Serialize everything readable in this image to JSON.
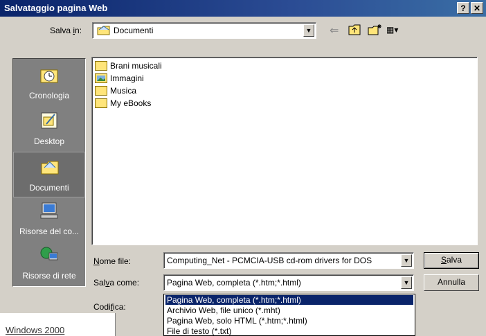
{
  "window": {
    "title": "Salvataggio pagina Web",
    "help_label": "?",
    "close_label": "✕"
  },
  "save_in": {
    "label_pre": "Salva ",
    "label_accel": "i",
    "label_post": "n:",
    "value": "Documenti",
    "icon": "folder-open-icon"
  },
  "toolbar": {
    "back_label": "⇐",
    "up_label": "⇧",
    "new_folder_label": "✱",
    "view_label": "▦▾"
  },
  "places": [
    {
      "label": "Cronologia",
      "icon": "history-icon",
      "selected": false
    },
    {
      "label": "Desktop",
      "icon": "desktop-icon",
      "selected": false
    },
    {
      "label": "Documenti",
      "icon": "documents-icon",
      "selected": true
    },
    {
      "label": "Risorse del co...",
      "icon": "computer-icon",
      "selected": false
    },
    {
      "label": "Risorse di rete",
      "icon": "network-icon",
      "selected": false
    }
  ],
  "files": [
    {
      "name": "Brani musicali",
      "icon": "folder-icon"
    },
    {
      "name": "Immagini",
      "icon": "folder-pictures-icon"
    },
    {
      "name": "Musica",
      "icon": "folder-icon"
    },
    {
      "name": "My eBooks",
      "icon": "folder-icon"
    }
  ],
  "filename": {
    "label_accel": "N",
    "label_post": "ome file:",
    "value": "Computing_Net - PCMCIA-USB cd-rom drivers for DOS"
  },
  "save_as": {
    "label_pre": "Sal",
    "label_accel": "v",
    "label_post": "a come:",
    "value": "Pagina Web, completa (*.htm;*.html)"
  },
  "encoding": {
    "label_pre": "Codi",
    "label_accel": "f",
    "label_post": "ica:"
  },
  "buttons": {
    "save_accel": "S",
    "save_post": "alva",
    "cancel": "Annulla"
  },
  "dropdown_options": [
    {
      "label": "Pagina Web, completa (*.htm;*.html)",
      "selected": true
    },
    {
      "label": "Archivio Web, file unico (*.mht)",
      "selected": false
    },
    {
      "label": "Pagina Web, solo HTML (*.htm;*.html)",
      "selected": false
    },
    {
      "label": "File di testo (*.txt)",
      "selected": false
    }
  ],
  "background_fragment": "Windows 2000",
  "combo_arrow": "▼"
}
